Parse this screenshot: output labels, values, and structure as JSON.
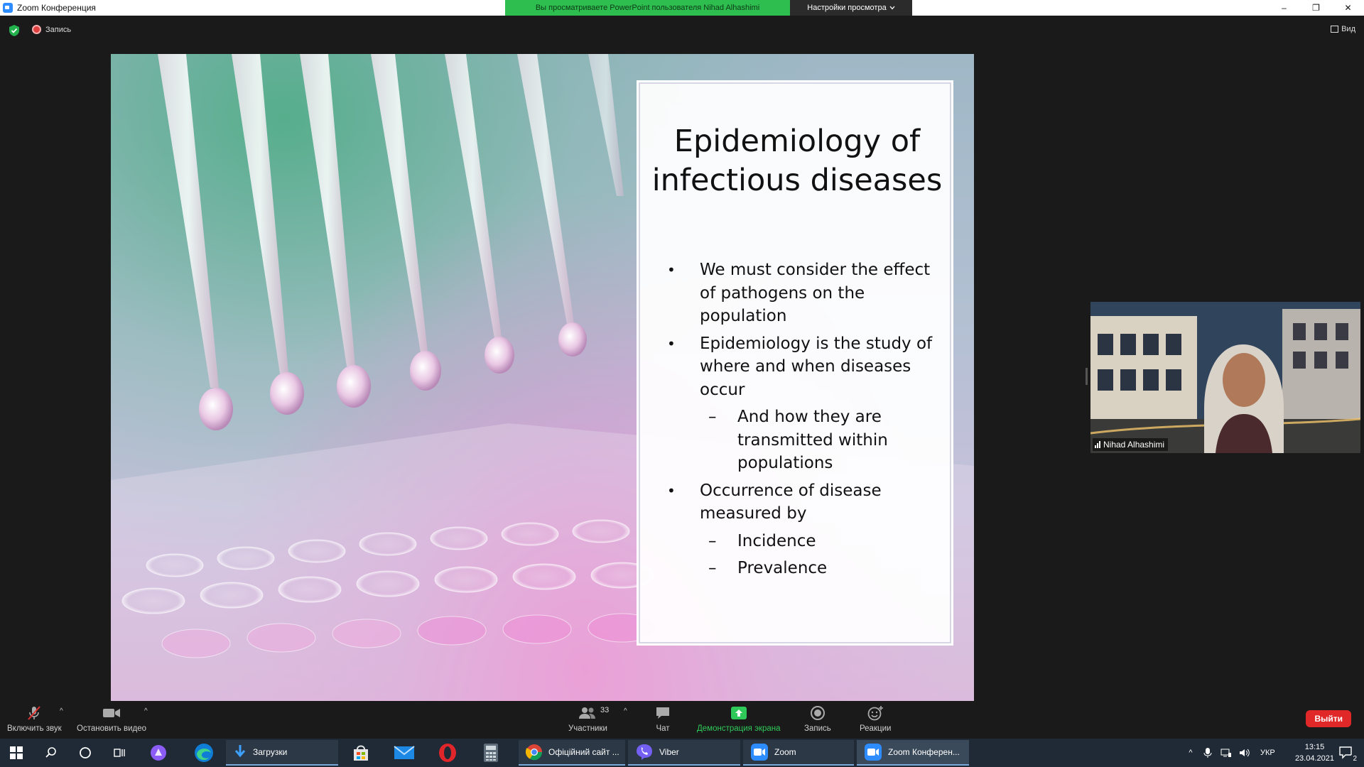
{
  "window": {
    "title": "Zoom Конференция",
    "share_banner": "Вы просматриваете PowerPoint пользователя Nihad Alhashimi",
    "view_settings": "Настройки просмотра",
    "minimize_glyph": "–",
    "restore_glyph": "❐",
    "close_glyph": "✕"
  },
  "meeting": {
    "recording_label": "Запись",
    "view_label": "Вид"
  },
  "slide": {
    "title": "Epidemiology of infectious diseases",
    "bullets": [
      {
        "level": 1,
        "text": "We must consider the effect of pathogens on the population"
      },
      {
        "level": 1,
        "text": "Epidemiology is  the study of where and when diseases occur"
      },
      {
        "level": 2,
        "text": "And how they are transmitted within populations"
      },
      {
        "level": 1,
        "text": "Occurrence of disease measured by"
      },
      {
        "level": 2,
        "text": "Incidence"
      },
      {
        "level": 2,
        "text": "Prevalence"
      }
    ]
  },
  "participant": {
    "name": "Nihad Alhashimi"
  },
  "toolbar": {
    "unmute": "Включить звук",
    "stop_video": "Остановить видео",
    "participants": "Участники",
    "participants_count": "33",
    "chat": "Чат",
    "share_screen": "Демонстрация экрана",
    "record": "Запись",
    "reactions": "Реакции",
    "leave": "Выйти"
  },
  "taskbar": {
    "apps": [
      {
        "label": "Загрузки"
      },
      {
        "label": "Офіційний сайт ..."
      },
      {
        "label": "Viber"
      },
      {
        "label": "Zoom"
      },
      {
        "label": "Zoom Конферен..."
      }
    ],
    "language": "УКР",
    "time": "13:15",
    "date": "23.04.2021",
    "notifications": "2"
  },
  "colors": {
    "accent_green": "#2ebd4f",
    "leave_red": "#e02828",
    "zoom_blue": "#2d8cff"
  }
}
